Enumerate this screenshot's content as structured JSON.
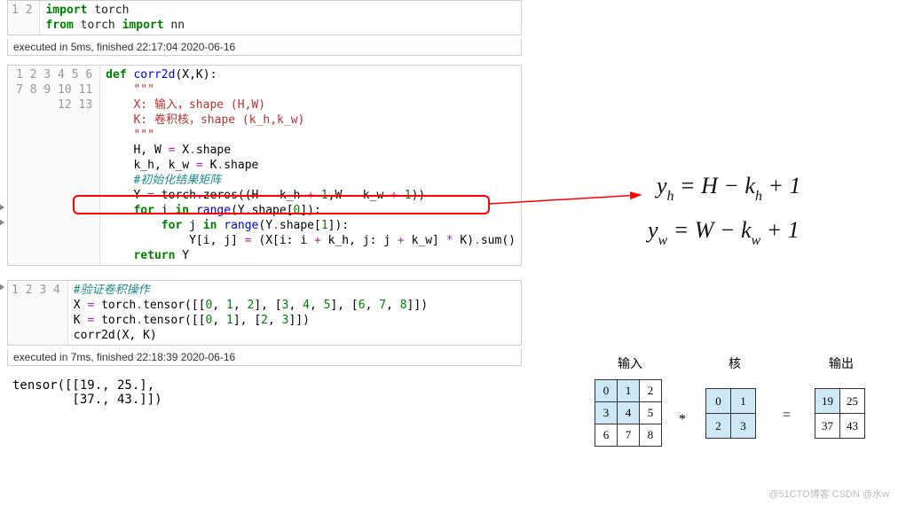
{
  "cell1": {
    "gutter": [
      "1",
      "2"
    ],
    "l1_kw1": "import",
    "l1_mod": "torch",
    "l2_kw1": "from",
    "l2_mod": "torch",
    "l2_kw2": "import",
    "l2_name": "nn",
    "exec": "executed in 5ms, finished 22:17:04 2020-06-16"
  },
  "cell2": {
    "gutter": [
      "1",
      "2",
      "3",
      "4",
      "5",
      "6",
      "7",
      "8",
      "9",
      "10",
      "11",
      "12",
      "13"
    ],
    "l1_def": "def ",
    "l1_fn": "corr2d",
    "l1_args": "(X,K):",
    "l2": "    \"\"\"",
    "l3": "    X: 输入，shape (H,W)",
    "l4": "    K: 卷积核，shape (k_h,k_w)",
    "l5": "    \"\"\"",
    "l6_a": "    H, W ",
    "l6_op": "=",
    "l6_b": " X",
    "l6_dot": ".",
    "l6_c": "shape",
    "l7_a": "    k_h, k_w ",
    "l7_op": "=",
    "l7_b": " K",
    "l7_dot": ".",
    "l7_c": "shape",
    "l8": "    #初始化结果矩阵",
    "l9_a": "    Y ",
    "l9_op": "=",
    "l9_b": " torch",
    "l9_dot": ".",
    "l9_fn": "zeros",
    "l9_c": "((H ",
    "l9_op2": "-",
    "l9_d": " k_h ",
    "l9_op3": "+",
    "l9_e": " ",
    "l9_n1": "1",
    "l9_f": ",W ",
    "l9_op4": "-",
    "l9_g": " k_w ",
    "l9_op5": "+",
    "l9_h": " ",
    "l9_n2": "1",
    "l9_i": "))",
    "l10_a": "    ",
    "l10_kw": "for",
    "l10_b": " i ",
    "l10_kw2": "in",
    "l10_c": " ",
    "l10_fn": "range",
    "l10_d": "(Y",
    "l10_dot": ".",
    "l10_e": "shape[",
    "l10_n": "0",
    "l10_f": "]):",
    "l11_a": "        ",
    "l11_kw": "for",
    "l11_b": " j ",
    "l11_kw2": "in",
    "l11_c": " ",
    "l11_fn": "range",
    "l11_d": "(Y",
    "l11_dot": ".",
    "l11_e": "shape[",
    "l11_n": "1",
    "l11_f": "]):",
    "l12_a": "            Y[i, j] ",
    "l12_op": "=",
    "l12_b": " (X[i: i ",
    "l12_op2": "+",
    "l12_c": " k_h, j: j ",
    "l12_op3": "+",
    "l12_d": " k_w] ",
    "l12_op4": "*",
    "l12_e": " K)",
    "l12_dot": ".",
    "l12_fn": "sum",
    "l12_f": "()",
    "l13_a": "    ",
    "l13_kw": "return",
    "l13_b": " Y"
  },
  "cell3": {
    "gutter": [
      "1",
      "2",
      "3",
      "4"
    ],
    "l1": "#验证卷积操作",
    "l2_a": "X ",
    "l2_op": "=",
    "l2_b": " torch",
    "l2_dot": ".",
    "l2_fn": "tensor",
    "l2_c": "([[",
    "l2_n0": "0",
    "l2_d": ", ",
    "l2_n1": "1",
    "l2_e": ", ",
    "l2_n2": "2",
    "l2_f": "], [",
    "l2_n3": "3",
    "l2_g": ", ",
    "l2_n4": "4",
    "l2_h": ", ",
    "l2_n5": "5",
    "l2_i": "], [",
    "l2_n6": "6",
    "l2_j": ", ",
    "l2_n7": "7",
    "l2_k": ", ",
    "l2_n8": "8",
    "l2_l": "]])",
    "l3_a": "K ",
    "l3_op": "=",
    "l3_b": " torch",
    "l3_dot": ".",
    "l3_fn": "tensor",
    "l3_c": "([[",
    "l3_n0": "0",
    "l3_d": ", ",
    "l3_n1": "1",
    "l3_e": "], [",
    "l3_n2": "2",
    "l3_f": ", ",
    "l3_n3": "3",
    "l3_g": "]])",
    "l4": "corr2d(X, K)",
    "exec": "executed in 7ms, finished 22:18:39 2020-06-16",
    "out": "tensor([[19., 25.],\n        [37., 43.]])"
  },
  "formula": {
    "f1_yh": "y",
    "f1_sub": "h",
    "f1_eq": " = H − k",
    "f1_sub2": "h",
    "f1_tail": " + 1",
    "f2_yw": "y",
    "f2_sub": "w",
    "f2_eq": " = W − k",
    "f2_sub2": "w",
    "f2_tail": " + 1"
  },
  "diagram": {
    "lbl_in": "输入",
    "lbl_ker": "核",
    "lbl_out": "输出",
    "star": "*",
    "eq": "=",
    "in": [
      [
        "0",
        "1",
        "2"
      ],
      [
        "3",
        "4",
        "5"
      ],
      [
        "6",
        "7",
        "8"
      ]
    ],
    "ker": [
      [
        "0",
        "1"
      ],
      [
        "2",
        "3"
      ]
    ],
    "out": [
      [
        "19",
        "25"
      ],
      [
        "37",
        "43"
      ]
    ]
  },
  "watermark": "@51CTO博客  CSDN @水w"
}
